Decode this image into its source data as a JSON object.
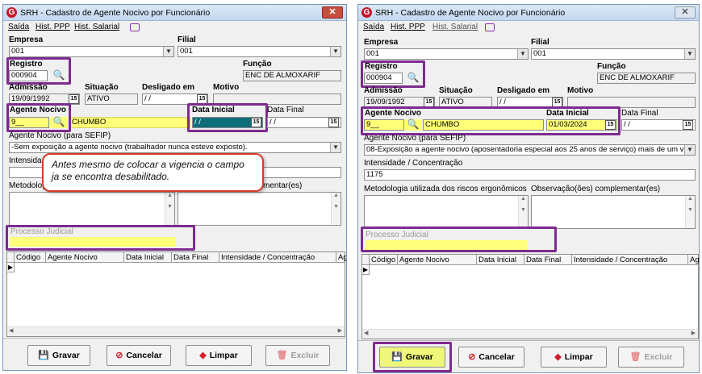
{
  "title": "SRH - Cadastro de Agente Nocivo por Funcionário",
  "menu": {
    "saida": "Saída",
    "hist_ppp": "Hist. PPP",
    "hist_salarial": "Hist. Salarial"
  },
  "labels": {
    "empresa": "Empresa",
    "filial": "Filial",
    "registro": "Registro",
    "funcao": "Função",
    "admissao": "Admissão",
    "situacao": "Situação",
    "desligado": "Desligado em",
    "motivo": "Motivo",
    "agente": "Agente Nocivo",
    "data_inicial": "Data Inicial",
    "data_final": "Data Final",
    "sefip": "Agente Nocivo (para SEFIP)",
    "intensidade": "Intensidade / Concentração",
    "metodologia": "Metodologia utilizada dos riscos ergonômicos",
    "observacao": "Observação(ões) complementar(es)",
    "processo": "Processo Judicial"
  },
  "left": {
    "empresa": "001",
    "filial": "001",
    "registro": "000904",
    "funcao": "ENC DE ALMOXARIF",
    "admissao": "19/09/1992",
    "situacao": "ATIVO",
    "desligado": " / /",
    "agente_code": "9__",
    "agente_name": "CHUMBO",
    "data_inicial": " / /",
    "data_final": " / /",
    "sefip": "-Sem exposição a agente nocivo (trabalhador nunca esteve exposto).",
    "intensidade_partial": "Intensida",
    "metodologia_partial": "Metodolog",
    "observacao_partial": "mentar(es)",
    "callout": "Antes mesmo de colocar a vigencia o campo ja se encontra desabilitado."
  },
  "right": {
    "empresa": "001",
    "filial": "001",
    "registro": "000904",
    "funcao": "ENC DE ALMOXARIF",
    "admissao": "19/09/1992",
    "situacao": "ATIVO",
    "desligado": " / /",
    "agente_code": "9__",
    "agente_name": "CHUMBO",
    "data_inicial": "01/03/2024",
    "data_final": " / /",
    "sefip": "08-Exposição a agente nocivo (aposentadoria especial aos 25 anos de serviço) mais de um víncul",
    "intensidade": "1175"
  },
  "grid_columns": [
    "Código",
    "Agente Nocivo",
    "Data Inicial",
    "Data Final",
    "Intensidade / Concentração",
    "Ag"
  ],
  "buttons": {
    "gravar": "Gravar",
    "cancelar": "Cancelar",
    "limpar": "Limpar",
    "excluir": "Excluir"
  },
  "icons": {
    "app": "app-logo-icon",
    "chat": "chat-icon",
    "search": "magnifier-icon",
    "calendar": "calendar-icon"
  },
  "colors": {
    "highlight": "#7e2b8f",
    "yellow": "#ffff7a",
    "callout_border": "#d63b2a"
  }
}
